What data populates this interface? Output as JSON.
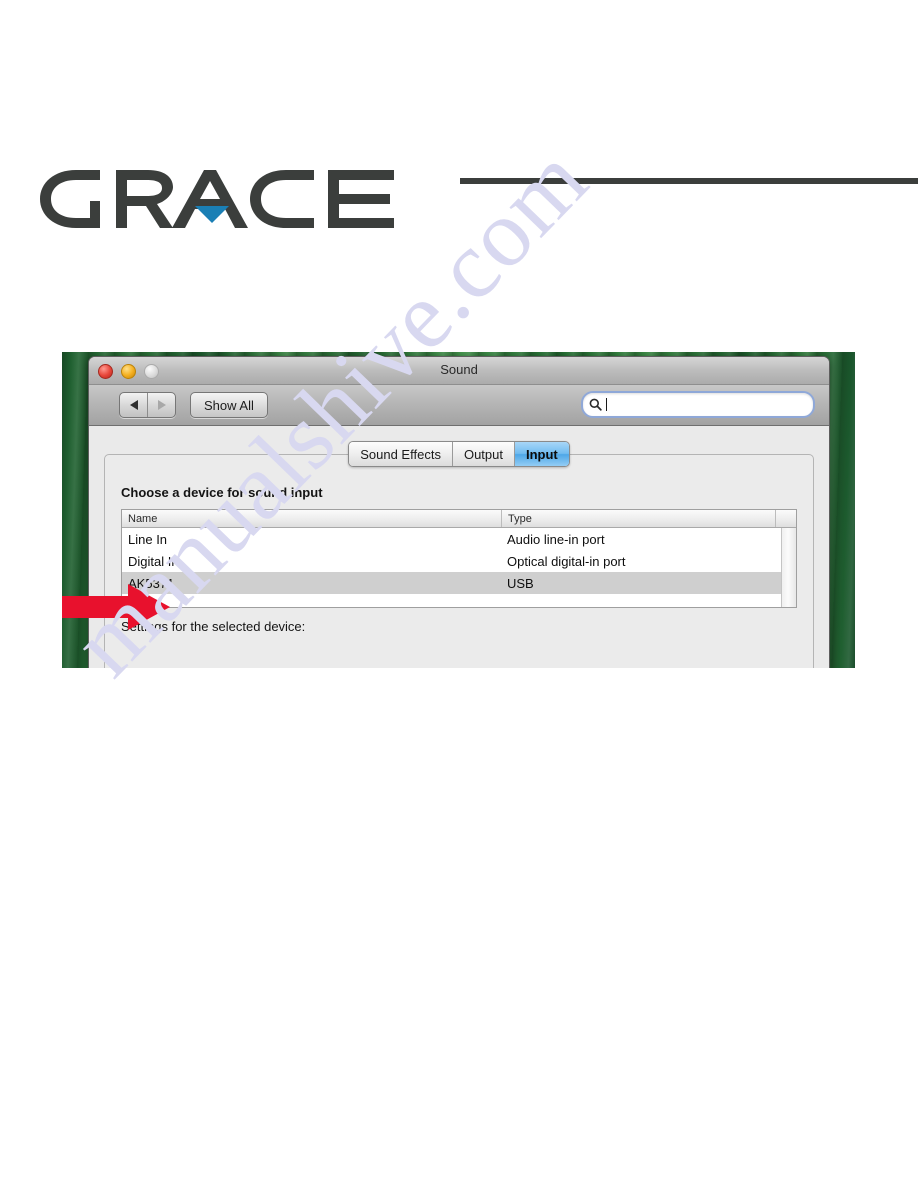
{
  "brand": {
    "logo_text": "GRACE",
    "logo_color": "#3b3e3c",
    "accent_triangle_color": "#1a7fb5"
  },
  "watermark": {
    "text": "manualshive.com",
    "color": "#d8d8f0"
  },
  "screenshot": {
    "desktop_color": "#2f7a3c",
    "window": {
      "title": "Sound",
      "traffic_lights": {
        "close": "close-button",
        "minimize": "minimize-button",
        "zoom": "zoom-button-disabled"
      },
      "toolbar": {
        "back_icon": "back-arrow-icon",
        "forward_icon": "forward-arrow-icon",
        "show_all_label": "Show All",
        "search": {
          "icon": "search-icon",
          "value": "",
          "placeholder": ""
        }
      },
      "tabs": [
        {
          "label": "Sound Effects",
          "selected": false
        },
        {
          "label": "Output",
          "selected": false
        },
        {
          "label": "Input",
          "selected": true
        }
      ],
      "pane": {
        "choose_label": "Choose a device for sound input",
        "table": {
          "columns": [
            "Name",
            "Type"
          ],
          "rows": [
            {
              "name": "Line In",
              "type": "Audio line-in port",
              "selected": false
            },
            {
              "name": "Digital In",
              "type": "Optical digital-in port",
              "selected": false
            },
            {
              "name": "AK5371",
              "type": "USB",
              "selected": true
            }
          ]
        },
        "settings_label": "Settings for the selected device:"
      }
    },
    "annotation": {
      "arrow_color": "#e8112d",
      "points_to": "AK5371"
    }
  }
}
